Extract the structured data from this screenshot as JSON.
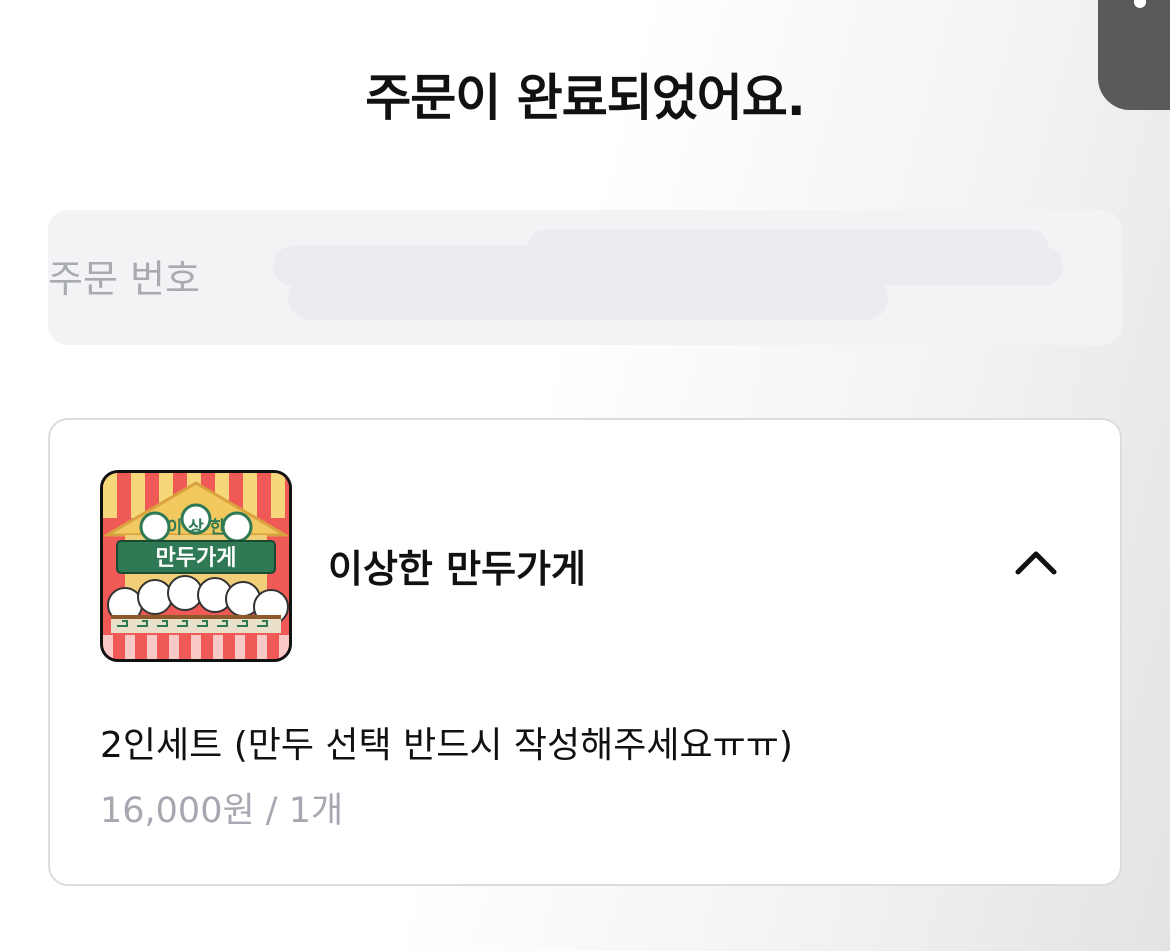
{
  "header": {
    "title": "주문이 완료되었어요."
  },
  "order": {
    "number_label": "주문 번호",
    "number_value": ""
  },
  "store": {
    "name": "이상한 만두가게",
    "logo_text_top": "이 상 한",
    "logo_text_bottom": "만두가게",
    "expand_icon": "chevron-up-icon"
  },
  "item": {
    "name": "2인세트 (만두 선택 반드시 작성해주세요ㅠㅠ)",
    "price_qty": "16,000원 / 1개"
  },
  "colors": {
    "title": "#111111",
    "muted": "#a9abb3",
    "box_bg": "#f3f3f6",
    "card_border": "#dcdcdf",
    "logo_red": "#ef5a56",
    "logo_green": "#2f7a54"
  }
}
